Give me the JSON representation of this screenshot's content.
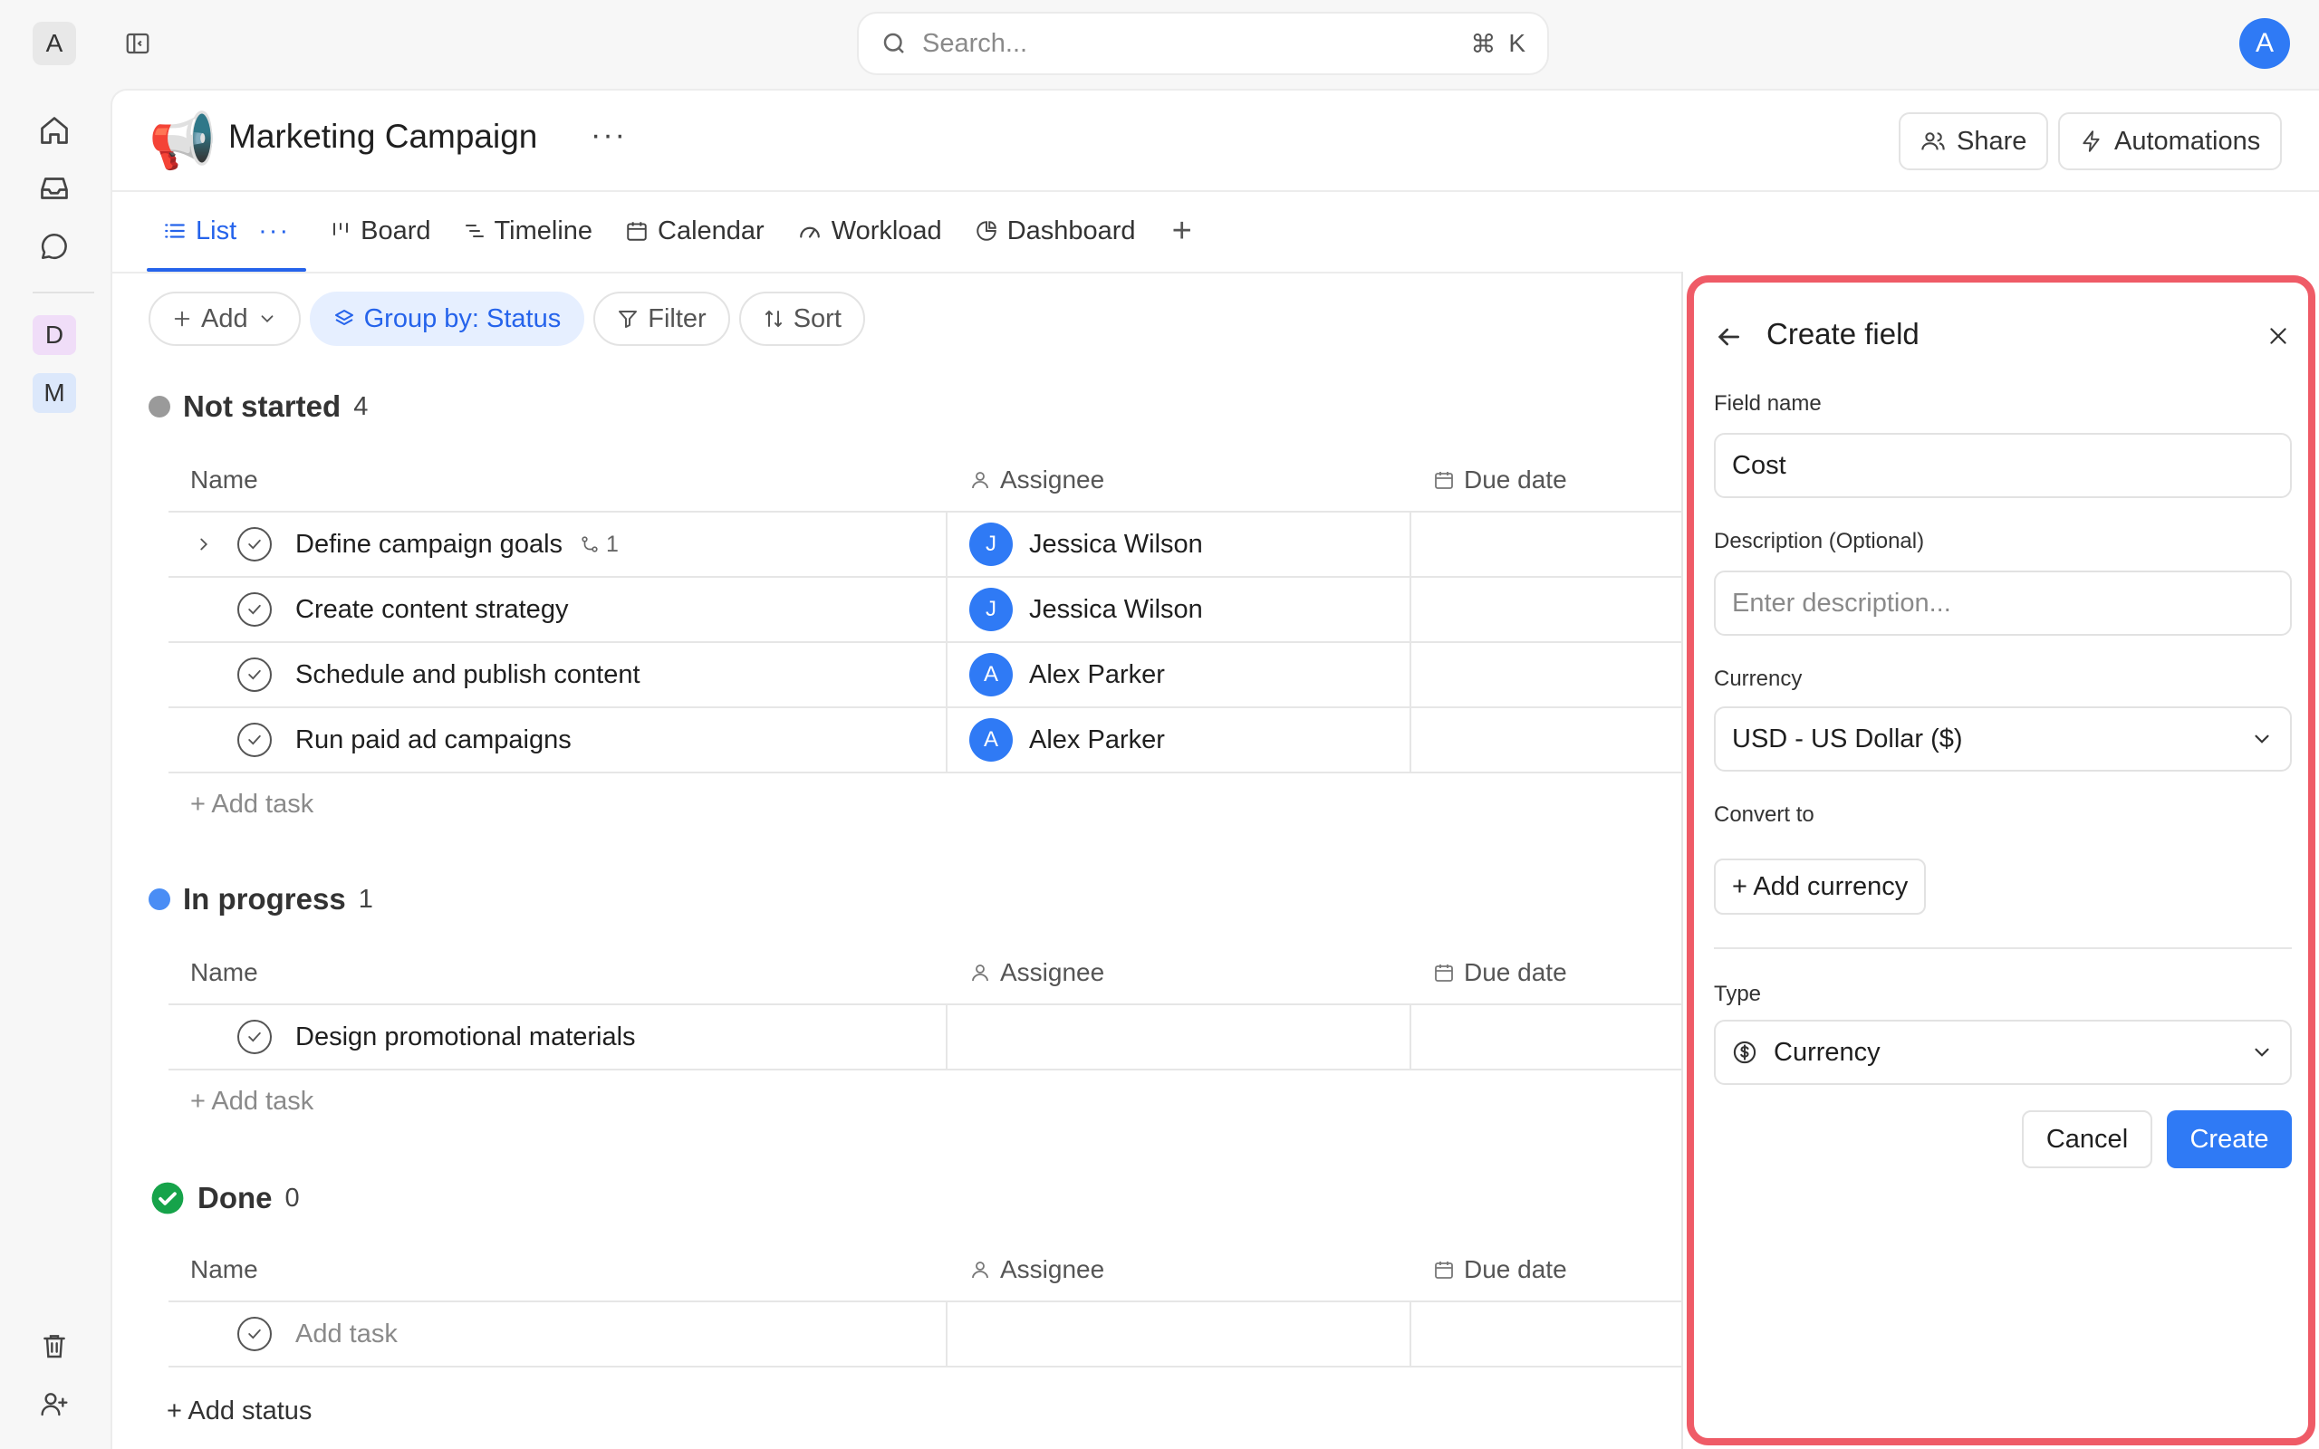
{
  "rail": {
    "logo_letter": "A",
    "workspaces": [
      {
        "letter": "D",
        "color": "#f0ddf8"
      },
      {
        "letter": "M",
        "color": "#dce8fb"
      }
    ]
  },
  "search": {
    "placeholder": "Search...",
    "shortcut_cmd": "⌘",
    "shortcut_key": "K"
  },
  "user": {
    "avatar_letter": "A"
  },
  "project": {
    "emoji": "📢",
    "title": "Marketing Campaign",
    "more": "···",
    "share_label": "Share",
    "automations_label": "Automations"
  },
  "tabs": {
    "list": "List",
    "list_more": "···",
    "board": "Board",
    "timeline": "Timeline",
    "calendar": "Calendar",
    "workload": "Workload",
    "dashboard": "Dashboard",
    "add": "+"
  },
  "toolbar": {
    "add": "Add",
    "group_by": "Group by: Status",
    "filter": "Filter",
    "sort": "Sort"
  },
  "columns": {
    "name": "Name",
    "assignee": "Assignee",
    "due": "Due date"
  },
  "groups": {
    "not_started": {
      "title": "Not started",
      "count": "4",
      "color": "#9a9a9a",
      "rows": [
        {
          "name": "Define campaign goals",
          "subtasks": "1",
          "assignee": "Jessica Wilson",
          "initial": "J"
        },
        {
          "name": "Create content strategy",
          "assignee": "Jessica Wilson",
          "initial": "J"
        },
        {
          "name": "Schedule and publish content",
          "assignee": "Alex Parker",
          "initial": "A"
        },
        {
          "name": "Run paid ad campaigns",
          "assignee": "Alex Parker",
          "initial": "A"
        }
      ],
      "add_task": "+ Add task"
    },
    "in_progress": {
      "title": "In progress",
      "count": "1",
      "color": "#4a8df5",
      "rows": [
        {
          "name": "Design promotional materials"
        }
      ],
      "add_task": "+ Add task"
    },
    "done": {
      "title": "Done",
      "count": "0",
      "color": "#16a34a",
      "placeholder": "Add task"
    }
  },
  "add_status": "+ Add status",
  "drawer": {
    "title": "Create field",
    "field_name_label": "Field name",
    "field_name_value": "Cost",
    "description_label": "Description (Optional)",
    "description_placeholder": "Enter description...",
    "currency_label": "Currency",
    "currency_value": "USD - US Dollar ($)",
    "convert_label": "Convert to",
    "add_currency": "+ Add currency",
    "type_label": "Type",
    "type_value": "Currency",
    "cancel": "Cancel",
    "create": "Create",
    "highlight_color": "#ef5b67",
    "accent_color": "#2f7af5"
  }
}
